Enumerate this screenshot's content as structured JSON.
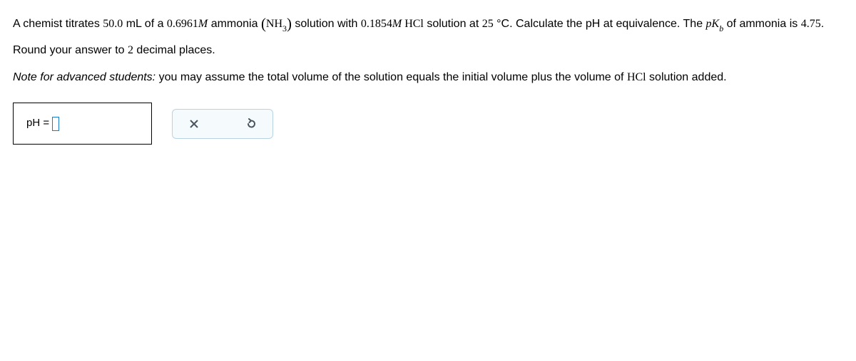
{
  "problem": {
    "line1_a": "A chemist titrates ",
    "vol_base": "50.0",
    "line1_b": " mL of a ",
    "conc_base": "0.6961",
    "molar1": "M",
    "line1_c": " ammonia ",
    "formula_base": "NH",
    "formula_base_sub": "3",
    "line1_d": " solution with ",
    "conc_acid": "0.1854",
    "molar2": "M",
    "formula_acid": " HCl",
    "line1_e": " solution at ",
    "temp": "25",
    "line1_f": " °C. Calculate the pH at equivalence. The ",
    "pkb_label_p": "p",
    "pkb_label_k": "K",
    "pkb_label_sub": "b",
    "line1_g": " of ammonia is ",
    "pkb_value": "4.75",
    "period1": ".",
    "line2_a": "Round your answer to ",
    "decimals": "2",
    "line2_b": " decimal places.",
    "note_prefix": "Note for advanced students:",
    "note_body": " you may assume the total volume of the solution equals the initial volume plus the volume of ",
    "note_formula": "HCl",
    "note_end": " solution added."
  },
  "answer": {
    "label": "pH = "
  }
}
